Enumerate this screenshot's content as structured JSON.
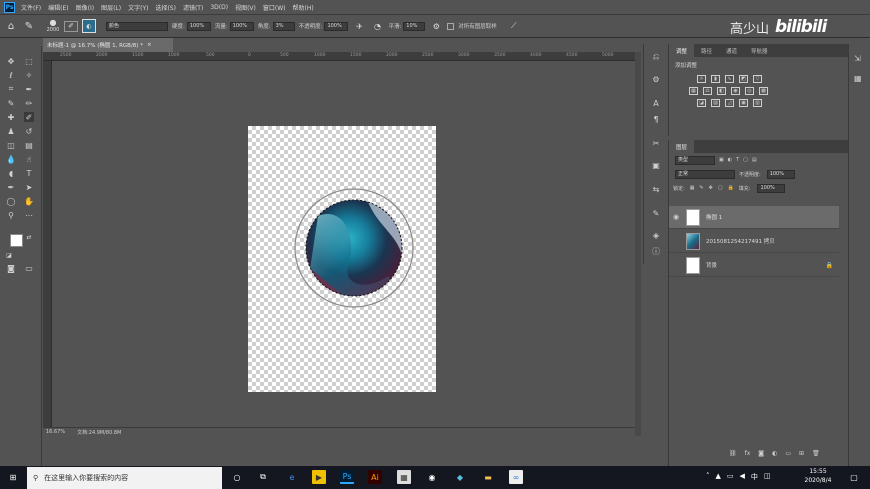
{
  "menu": {
    "app_icon": "Ps",
    "items": [
      "文件(F)",
      "编辑(E)",
      "图像(I)",
      "图层(L)",
      "文字(Y)",
      "选择(S)",
      "滤镜(T)",
      "3D(D)",
      "视图(V)",
      "窗口(W)",
      "帮助(H)"
    ]
  },
  "options": {
    "brush_size": "2000",
    "mode_value": "颜色",
    "opacity_label": "不透明度:",
    "opacity_value": "100%",
    "flow_label": "流量:",
    "flow_value": "100%",
    "smooth_label": "平滑:",
    "smooth_value": "10%",
    "hardness_label": "硬度:",
    "hardness_value": "100%",
    "angle_label": "角度:",
    "angle_value": "3%",
    "sample_checkbox_label": "对所有图层取样"
  },
  "watermark": {
    "name": "高少山",
    "brand": "bilibili"
  },
  "document": {
    "tab_title": "未标题-1 @ 16.7% (椭圆 1, RGB/8) *",
    "close_icon": "×",
    "ruler_ticks": [
      "2500",
      "2000",
      "1500",
      "1000",
      "500",
      "0",
      "500",
      "1000",
      "1500",
      "2000",
      "2500",
      "3000",
      "3500",
      "4000",
      "4500",
      "5000"
    ]
  },
  "status": {
    "zoom": "16.67%",
    "doc_info": "文档:24.9M/80.8M"
  },
  "adjust_panel": {
    "tabs": [
      "调整",
      "路径",
      "通道",
      "导航器"
    ],
    "title": "添加调整"
  },
  "layers_panel": {
    "title": "图层",
    "filter_kind": "类型",
    "blend_mode": "正常",
    "opacity_label": "不透明度:",
    "opacity_value": "100%",
    "lock_label": "锁定:",
    "fill_label": "填充:",
    "fill_value": "100%",
    "layers": [
      {
        "name": "椭圆 1",
        "visible": true,
        "selected": true
      },
      {
        "name": "20150812542174​91 拷贝",
        "visible": false,
        "selected": false
      },
      {
        "name": "背景",
        "visible": false,
        "selected": false,
        "locked": true
      }
    ]
  },
  "taskbar": {
    "search_placeholder": "在这里输入你要搜索的内容",
    "time": "15:55",
    "date": "2020/8/4",
    "ime": "中",
    "app_ps": "Ps",
    "app_ai": "Ai"
  },
  "colors": {
    "accent": "#31a8ff",
    "panel": "#535353",
    "canvas_bg": "#535353",
    "selected_layer": "#6b6b6b"
  }
}
